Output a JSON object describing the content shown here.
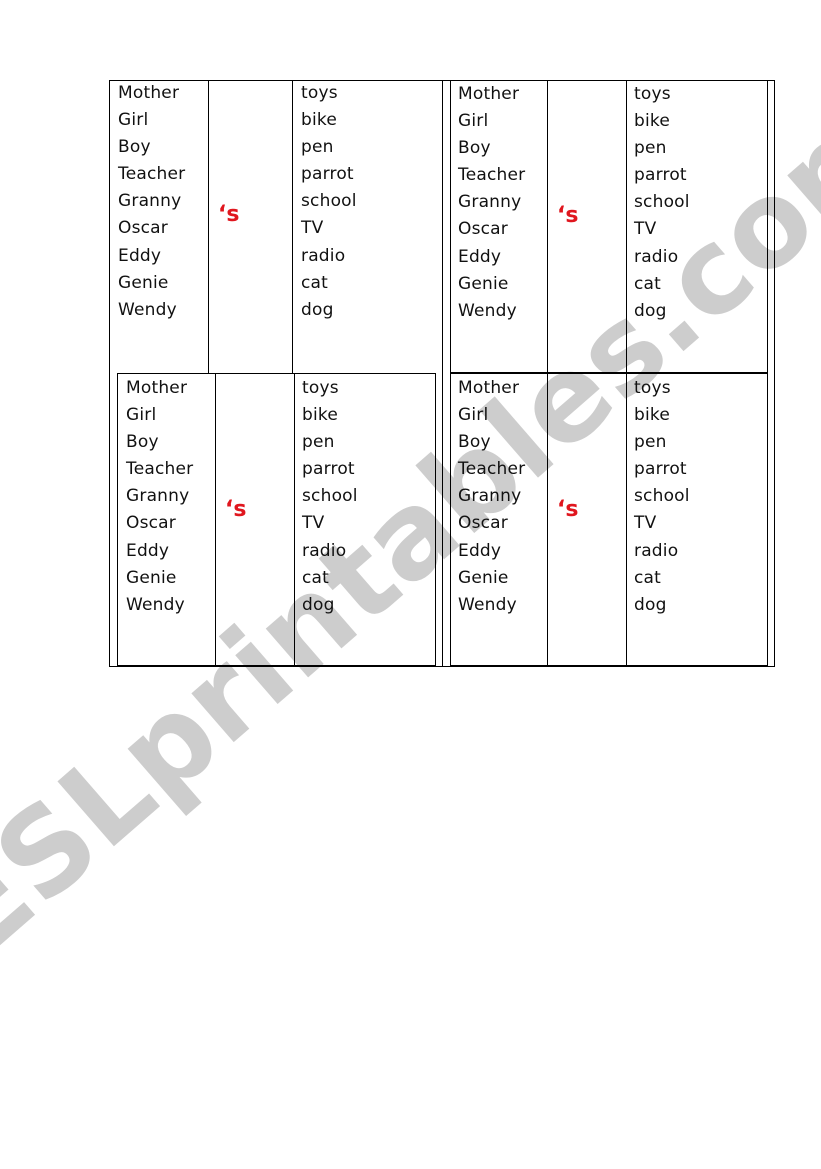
{
  "worksheet": {
    "watermark": "ESLprintables.com",
    "accent_color": "#e0161e",
    "cards": [
      {
        "subjects": [
          "Mother",
          "Girl",
          "Boy",
          "Teacher",
          "Granny",
          "Oscar",
          "Eddy",
          "Genie",
          "Wendy"
        ],
        "possessive": "‘s",
        "objects": [
          "toys",
          "bike",
          "pen",
          "parrot",
          "school",
          "TV",
          "radio",
          "cat",
          "dog"
        ]
      },
      {
        "subjects": [
          "Mother",
          "Girl",
          "Boy",
          "Teacher",
          "Granny",
          "Oscar",
          "Eddy",
          "Genie",
          "Wendy"
        ],
        "possessive": "‘s",
        "objects": [
          "toys",
          "bike",
          "pen",
          "parrot",
          "school",
          "TV",
          "radio",
          "cat",
          "dog"
        ]
      },
      {
        "subjects": [
          "Mother",
          "Girl",
          "Boy",
          "Teacher",
          "Granny",
          "Oscar",
          "Eddy",
          "Genie",
          "Wendy"
        ],
        "possessive": "‘s",
        "objects": [
          "toys",
          "bike",
          "pen",
          "parrot",
          "school",
          "TV",
          "radio",
          "cat",
          "dog"
        ]
      },
      {
        "subjects": [
          "Mother",
          "Girl",
          "Boy",
          "Teacher",
          "Granny",
          "Oscar",
          "Eddy",
          "Genie",
          "Wendy"
        ],
        "possessive": "‘s",
        "objects": [
          "toys",
          "bike",
          "pen",
          "parrot",
          "school",
          "TV",
          "radio",
          "cat",
          "dog"
        ]
      }
    ]
  }
}
